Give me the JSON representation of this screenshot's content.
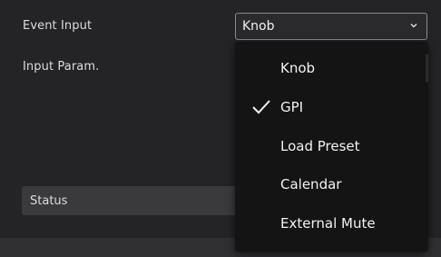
{
  "form": {
    "event_input_label": "Event Input",
    "input_param_label": "Input Param.",
    "status_label": "Status"
  },
  "event_select": {
    "selected": "Knob",
    "icon": "chevron-down-icon"
  },
  "dropdown": {
    "options": [
      {
        "label": "Knob",
        "checked": false
      },
      {
        "label": "GPI",
        "checked": true
      },
      {
        "label": "Load Preset",
        "checked": false
      },
      {
        "label": "Calendar",
        "checked": false
      },
      {
        "label": "External Mute",
        "checked": false
      }
    ],
    "check_icon": "checkmark-icon"
  },
  "colors": {
    "background": "#242426",
    "dropdown_background": "#141415",
    "status_background": "#3a3a3d",
    "border": "#8a8a8e"
  }
}
